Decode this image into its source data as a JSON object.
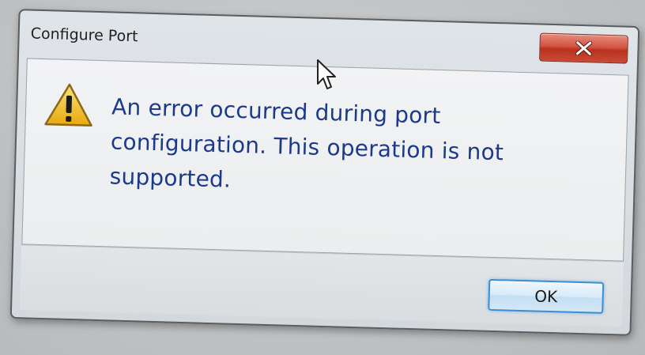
{
  "dialog": {
    "title": "Configure Port",
    "message": "An error occurred during port configuration. This operation is not supported.",
    "icon": "warning-icon",
    "buttons": {
      "close_icon": "close-icon",
      "ok_label": "OK"
    }
  },
  "colors": {
    "message_text": "#1c3a8a",
    "close_button": "#c94a35",
    "ok_button_border": "#3b8fd1",
    "warning_fill": "#f2c21b"
  },
  "pointer": {
    "icon": "mouse-cursor-icon"
  }
}
